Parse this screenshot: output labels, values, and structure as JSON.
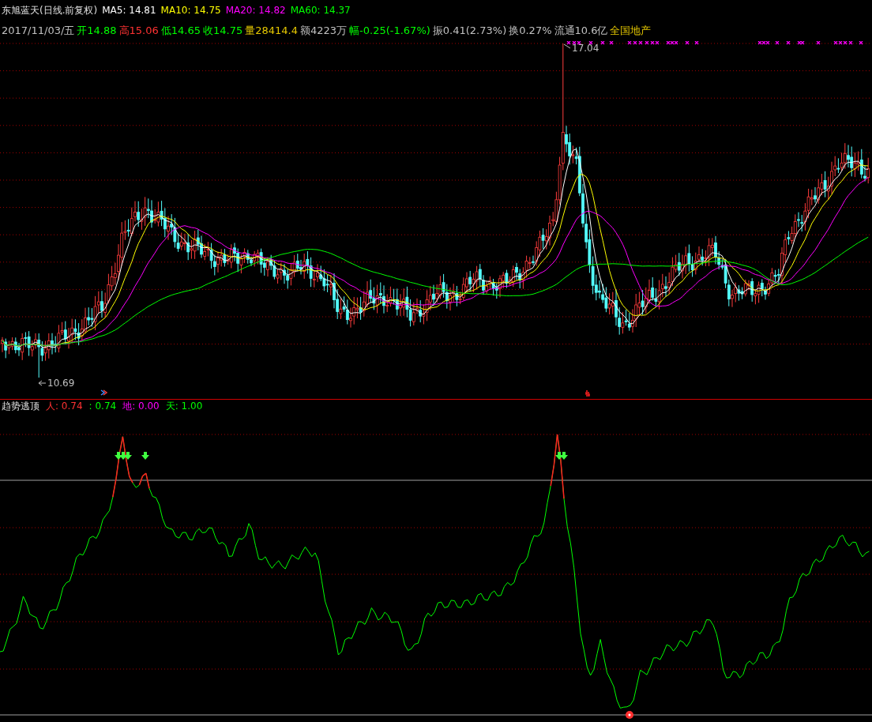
{
  "header": {
    "title": "东旭蓝天(日线.前复权)",
    "averages": [
      {
        "label": "MA5: 14.81",
        "color": "#ffffff"
      },
      {
        "label": "MA10: 14.75",
        "color": "#ffff00"
      },
      {
        "label": "MA20: 14.82",
        "color": "#ff00ff"
      },
      {
        "label": "MA60: 14.37",
        "color": "#00ff00"
      }
    ]
  },
  "quote": [
    {
      "text": "2017/11/03/五",
      "color": "#c0c0c0"
    },
    {
      "text": "开14.88",
      "color": "#00ff00"
    },
    {
      "text": "高15.06",
      "color": "#ff3232"
    },
    {
      "text": "低14.65",
      "color": "#00ff00"
    },
    {
      "text": "收14.75",
      "color": "#00ff00"
    },
    {
      "text": "量28414.4",
      "color": "#e6c800"
    },
    {
      "text": "额4223万",
      "color": "#c0c0c0"
    },
    {
      "text": "幅-0.25(-1.67%)",
      "color": "#00ff00"
    },
    {
      "text": "振0.41(2.73%)",
      "color": "#c0c0c0"
    },
    {
      "text": "换0.27%",
      "color": "#c0c0c0"
    },
    {
      "text": "流通10.6亿",
      "color": "#c0c0c0"
    },
    {
      "text": "全国地产",
      "color": "#e6c800"
    }
  ],
  "price_chart": {
    "high_label": "17.04",
    "low_label": "10.69"
  },
  "indicator": {
    "name": "趋势逃顶",
    "values": [
      {
        "label": "人: 0.74",
        "color": "#ff3232"
      },
      {
        "label": ": 0.74",
        "color": "#00ff00"
      },
      {
        "label": "地: 0.00",
        "color": "#ff00ff"
      },
      {
        "label": "天: 1.00",
        "color": "#00ff00"
      }
    ]
  }
}
